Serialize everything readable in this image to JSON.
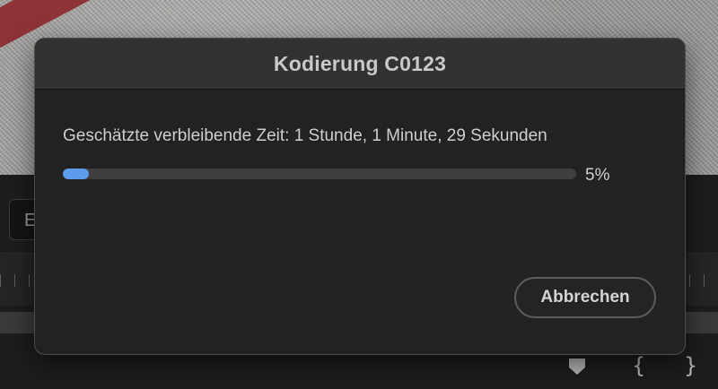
{
  "background": {
    "field_text": "E",
    "marker_icon": "playhead-marker-icon",
    "in_point_icon": "in-point-brace-icon",
    "out_point_icon": "out-point-brace-icon"
  },
  "dialog": {
    "title": "Kodierung C0123",
    "estimate_text": "Geschätzte verbleibende Zeit: 1 Stunde, 1 Minute, 29 Sekunden",
    "progress_percent": 5,
    "progress_label": "5%",
    "cancel_label": "Abbrechen"
  },
  "colors": {
    "progress_fill": "#5d9cec",
    "dialog_bg": "#222222",
    "header_bg": "#323232"
  }
}
